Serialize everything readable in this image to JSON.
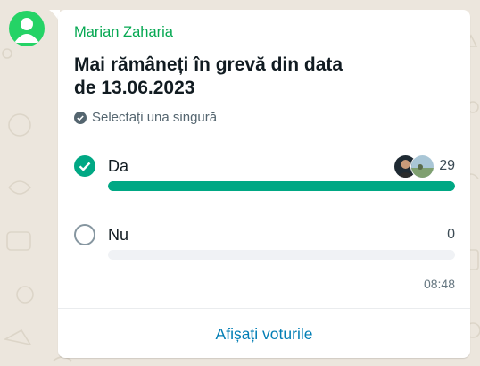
{
  "message": {
    "sender": "Marian Zaharia",
    "time": "08:48"
  },
  "poll": {
    "question": "Mai rămâneți în grevă din data de 13.06.2023",
    "hint": "Selectați una singură",
    "options": [
      {
        "label": "Da",
        "count": "29",
        "selected": true,
        "fill": 1.0
      },
      {
        "label": "Nu",
        "count": "0",
        "selected": false,
        "fill": 0.0
      }
    ],
    "view_votes_label": "Afișați voturile"
  },
  "colors": {
    "accent": "#00a884",
    "sender": "#06a852",
    "link": "#027eb5",
    "wallpaper": "#ece6dd"
  },
  "icons": {
    "avatar": "default-user-icon",
    "hint": "check-circle-icon",
    "selected": "checked-circle-icon",
    "unselected": "empty-circle-icon"
  }
}
